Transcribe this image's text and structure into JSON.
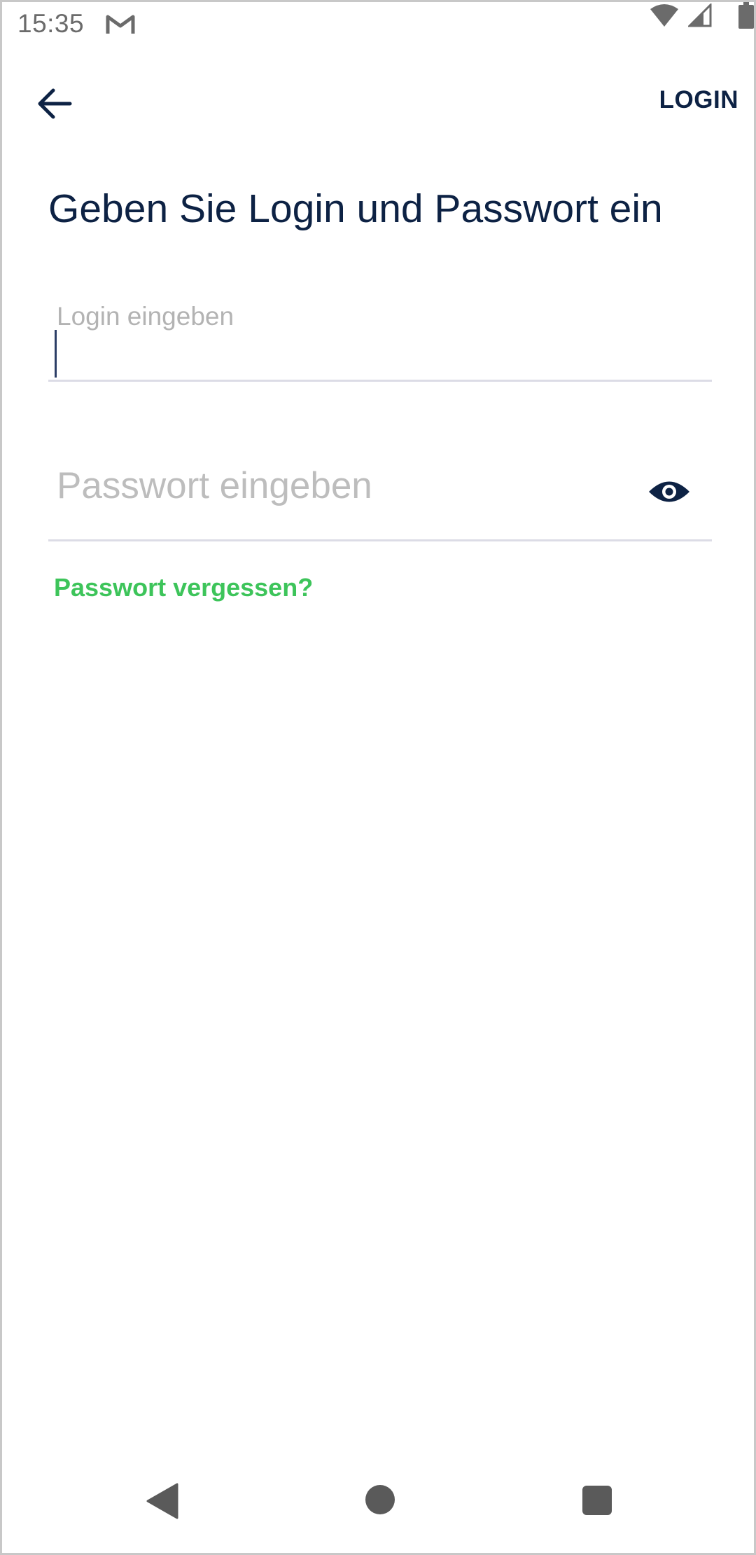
{
  "status_bar": {
    "time": "15:35",
    "notification_icon": "gmail-icon",
    "wifi_icon": "wifi-icon",
    "signal_icon": "signal-icon",
    "battery_icon": "battery-icon"
  },
  "app_bar": {
    "back_icon": "arrow-left-icon",
    "action_label": "LOGIN"
  },
  "main": {
    "title": "Geben Sie Login und Passwort ein",
    "login_field": {
      "label": "Login eingeben",
      "value": ""
    },
    "password_field": {
      "placeholder": "Passwort eingeben",
      "value": "",
      "toggle_icon": "eye-icon"
    },
    "forgot_password_label": "Passwort vergessen?"
  },
  "nav_bar": {
    "back_icon": "triangle-back-icon",
    "home_icon": "circle-home-icon",
    "recents_icon": "square-recents-icon"
  },
  "colors": {
    "primary": "#0d2244",
    "accent_green": "#3dc45a",
    "hint_gray": "#b3b3b3",
    "divider": "#dcdce6"
  }
}
